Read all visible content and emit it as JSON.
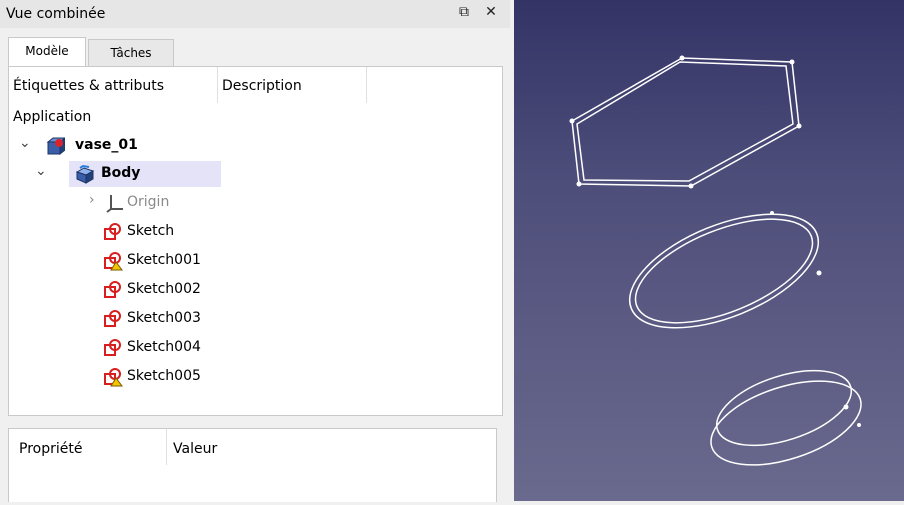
{
  "panel": {
    "title": "Vue combinée",
    "float_glyph": "⧉",
    "close_glyph": "✕",
    "tabs": [
      {
        "label": "Modèle",
        "active": true
      },
      {
        "label": "Tâches",
        "active": false
      }
    ]
  },
  "tree": {
    "columns": [
      "Étiquettes & attributs",
      "Description"
    ],
    "application_label": "Application",
    "items": [
      {
        "label": "vase_01",
        "bold": true,
        "expanded": true,
        "icon": "document-part-icon"
      },
      {
        "label": "Body",
        "bold": true,
        "expanded": true,
        "icon": "body-icon",
        "selected": true
      },
      {
        "label": "Origin",
        "bold": false,
        "expanded": false,
        "icon": "origin-icon",
        "greyed": true
      },
      {
        "label": "Sketch",
        "icon": "sketch-icon"
      },
      {
        "label": "Sketch001",
        "icon": "sketch-warning-icon"
      },
      {
        "label": "Sketch002",
        "icon": "sketch-icon"
      },
      {
        "label": "Sketch003",
        "icon": "sketch-icon"
      },
      {
        "label": "Sketch004",
        "icon": "sketch-icon"
      },
      {
        "label": "Sketch005",
        "icon": "sketch-warning-icon"
      }
    ]
  },
  "properties": {
    "columns": [
      "Propriété",
      "Valeur"
    ]
  },
  "viewport": {
    "background_top": "#333366",
    "background_bottom": "#6a6a8e",
    "shapes": [
      "hexagon-sketch",
      "ellipse-sketch",
      "ellipse-sketch-small"
    ]
  }
}
